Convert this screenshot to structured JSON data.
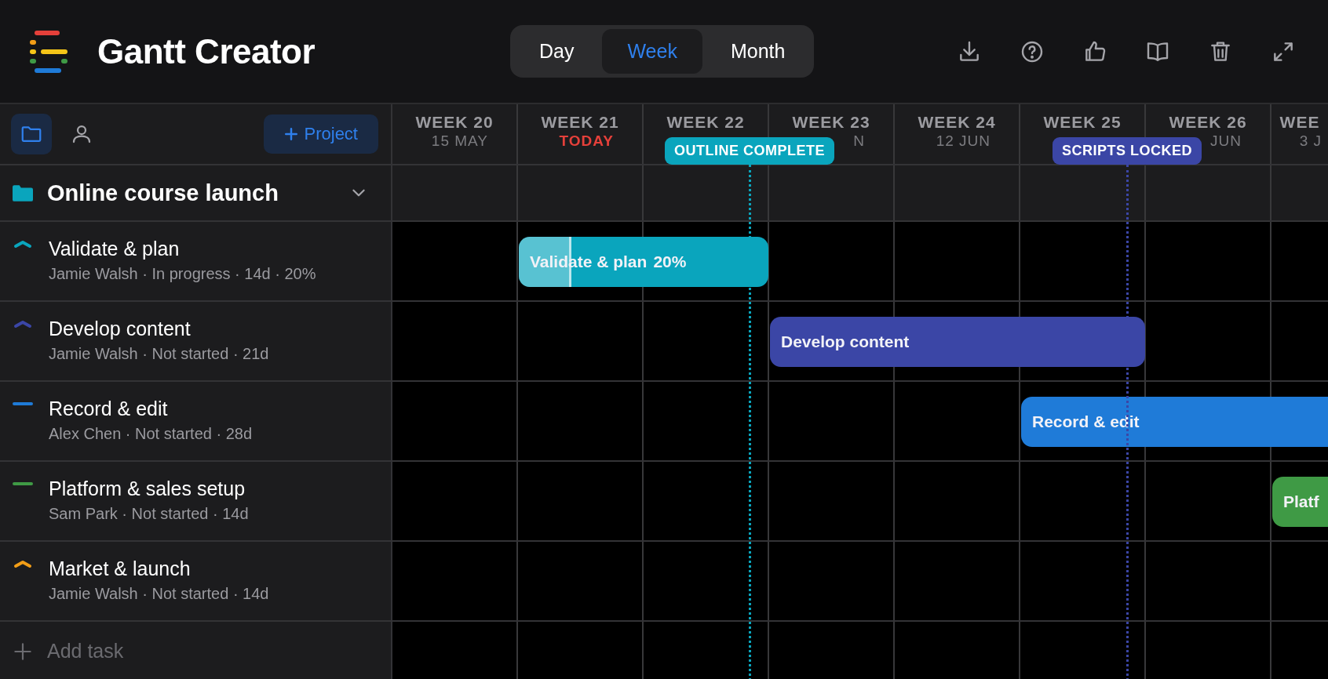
{
  "app": {
    "title": "Gantt Creator"
  },
  "view_modes": [
    {
      "label": "Day",
      "selected": false
    },
    {
      "label": "Week",
      "selected": true
    },
    {
      "label": "Month",
      "selected": false
    }
  ],
  "sidebar": {
    "views": [
      {
        "kind": "folder",
        "selected": true
      },
      {
        "kind": "person",
        "selected": false
      }
    ],
    "add_project": "Project"
  },
  "weeks": [
    {
      "label": "WEEK 20",
      "date": "15 MAY",
      "today": false
    },
    {
      "label": "WEEK 21",
      "date": "TODAY",
      "today": true
    },
    {
      "label": "WEEK 22",
      "today": false
    },
    {
      "label": "WEEK 23",
      "date": "N",
      "today": false
    },
    {
      "label": "WEEK 24",
      "date": "12 JUN",
      "today": false
    },
    {
      "label": "WEEK 25",
      "today": false
    },
    {
      "label": "WEEK 26",
      "date": "JUN",
      "today": false
    },
    {
      "label": "WEE",
      "date": "3 J",
      "today": false
    }
  ],
  "milestones": [
    {
      "label": "OUTLINE COMPLETE",
      "color": "#0aa5bd"
    },
    {
      "label": "SCRIPTS LOCKED",
      "color": "#3b46a6"
    }
  ],
  "project": {
    "name": "Online course launch",
    "expanded": true
  },
  "tasks": [
    {
      "name": "Validate & plan",
      "meta": "Jamie Walsh · In progress · 14d · 20%",
      "color": "#0aa5bd",
      "kind": "chevron",
      "bar": {
        "label": "Validate & plan",
        "progress_text": "20%",
        "level": 0.2
      }
    },
    {
      "name": "Develop content",
      "meta": "Jamie Walsh · Not started · 21d",
      "color": "#3b46a6",
      "kind": "chevron",
      "bar": {
        "label": "Develop content"
      }
    },
    {
      "name": "Record & edit",
      "meta": "Alex Chen · Not started · 28d",
      "color": "#1f7bd8",
      "kind": "dash",
      "bar": {
        "label": "Record & edit"
      }
    },
    {
      "name": "Platform & sales setup",
      "meta": "Sam Park · Not started · 14d",
      "color": "#3f9a45",
      "kind": "dash",
      "bar": {
        "label": "Platf"
      }
    },
    {
      "name": "Market & launch",
      "meta": "Jamie Walsh · Not started · 14d",
      "color": "#f29d17",
      "kind": "chevron"
    }
  ],
  "add_task": "Add task"
}
